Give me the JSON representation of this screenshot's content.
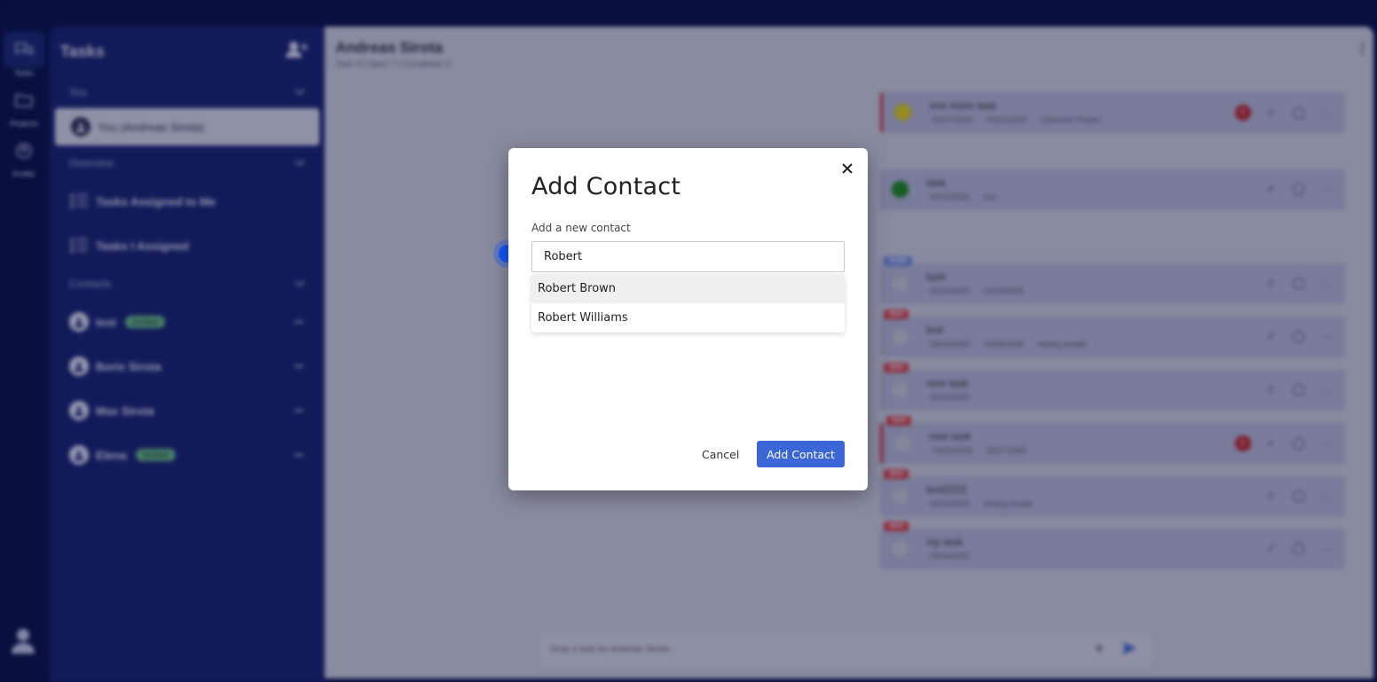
{
  "rail": {
    "items": [
      {
        "label": "Tasks",
        "icon": "chat-icon"
      },
      {
        "label": "Projects",
        "icon": "folder-icon"
      },
      {
        "label": "Profile",
        "icon": "profile-icon"
      }
    ]
  },
  "sidebar": {
    "title": "Tasks",
    "you_section": "You",
    "you_item": "You (Andreas Sirota)",
    "overview_section": "Overview",
    "nav": [
      "Tasks Assigned to Me",
      "Tasks I Assigned"
    ],
    "contacts_section": "Contacts",
    "contacts": [
      {
        "name": "test",
        "badge": "Invited"
      },
      {
        "name": "Boris Sirota",
        "badge": ""
      },
      {
        "name": "Max Sirota",
        "badge": ""
      },
      {
        "name": "Elena",
        "badge": "Invited"
      }
    ]
  },
  "main": {
    "title": "Andreas Sirota",
    "subtitle": "Total: 9 | Open: 7 | Completed: 2",
    "composer_placeholder": "Drop a task for Andreas Sirota...",
    "tasks": [
      {
        "name": "one more task",
        "meta": [
          "02/27/2025",
          "03/21/2025",
          "Unknown Project"
        ],
        "tag": "",
        "dot": "#e0d21a",
        "alert": true
      },
      {
        "name": "task",
        "meta": [
          "03/14/2025",
          "test"
        ],
        "tag": "",
        "dot": "#1c8a1c",
        "alert": false
      },
      {
        "name": "task",
        "meta": [
          "03/15/2025",
          "03/18/2025"
        ],
        "tag": "DONE",
        "dot": "#c9cad5",
        "alert": false
      },
      {
        "name": "test",
        "meta": [
          "03/15/2025",
          "03/26/2025",
          "testing emails"
        ],
        "tag": "NEW",
        "dot": "#c9cad5",
        "alert": false
      },
      {
        "name": "new task",
        "meta": [
          "03/15/2025"
        ],
        "tag": "NEW",
        "dot": "#c9cad5",
        "alert": false
      },
      {
        "name": "new task",
        "meta": [
          "03/15/2025",
          "03/17/2025"
        ],
        "tag": "NEW",
        "dot": "#c9cad5",
        "alert": true
      },
      {
        "name": "test2222",
        "meta": [
          "03/15/2025",
          "testing emails"
        ],
        "tag": "NEW",
        "dot": "#c9cad5",
        "alert": false
      },
      {
        "name": "my task",
        "meta": [
          "03/15/2025"
        ],
        "tag": "NEW",
        "dot": "#c9cad5",
        "alert": false
      }
    ]
  },
  "modal": {
    "title": "Add Contact",
    "field_label": "Add a new contact",
    "input_value": "Robert",
    "suggestions": [
      "Robert Brown",
      "Robert Williams"
    ],
    "cancel_label": "Cancel",
    "submit_label": "Add Contact"
  },
  "colors": {
    "accent": "#3b66d6",
    "sidebar_bg": "#1b2470",
    "app_bg": "#0b1347"
  }
}
